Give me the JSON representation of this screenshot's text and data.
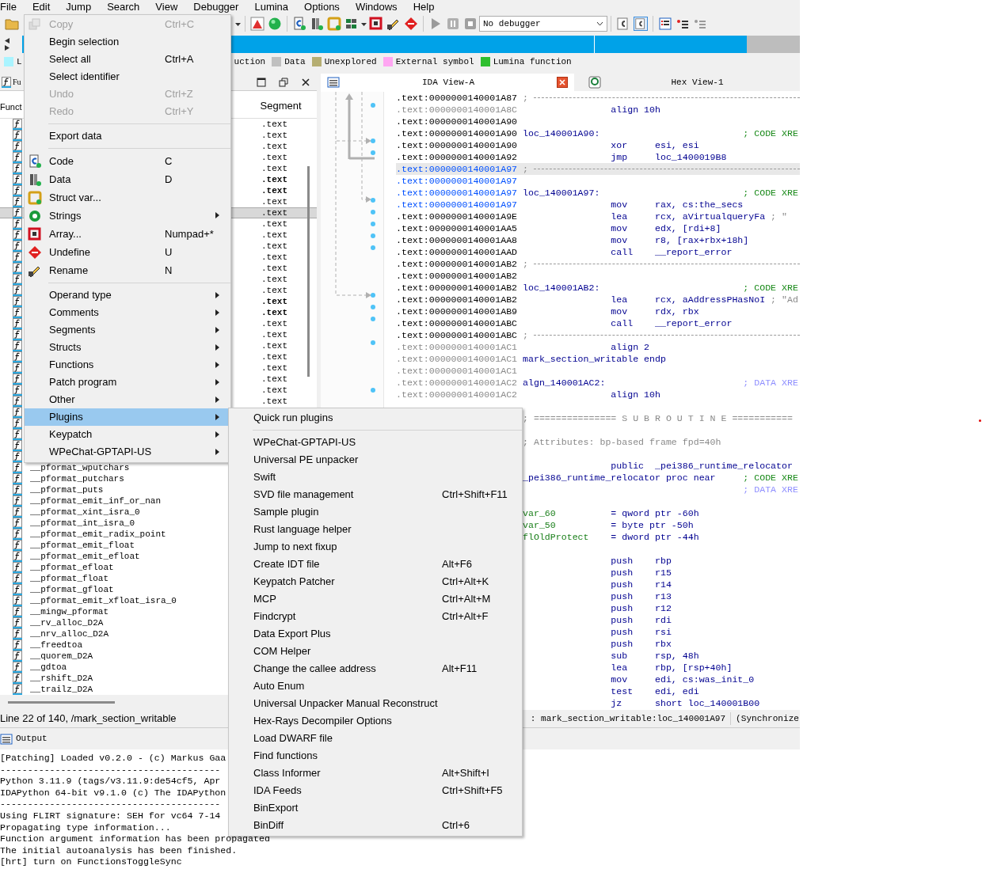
{
  "menubar": [
    {
      "label": "File"
    },
    {
      "label": "Edit"
    },
    {
      "label": "Jump"
    },
    {
      "label": "Search"
    },
    {
      "label": "View"
    },
    {
      "label": "Debugger"
    },
    {
      "label": "Lumina"
    },
    {
      "label": "Options"
    },
    {
      "label": "Windows"
    },
    {
      "label": "Help"
    }
  ],
  "toolbar": {
    "debugger_select": "No debugger"
  },
  "legend": [
    {
      "label": "L",
      "color": "#aaf4ff"
    },
    {
      "label": "uction"
    },
    {
      "label": "Data",
      "color": "#c0c0c0"
    },
    {
      "label": "Unexplored",
      "color": "#b5ae72"
    },
    {
      "label": "External symbol",
      "color": "#ffa6f2"
    },
    {
      "label": "Lumina function",
      "color": "#2fbf2f"
    }
  ],
  "functions": {
    "tab": "Fu",
    "column_1": "Funct",
    "column_2": "Segment",
    "status": "Line 22 of 140, /mark_section_writable",
    "rows": [
      {
        "segment": ".text",
        "bold": false,
        "selected": false
      },
      {
        "segment": ".text",
        "bold": false,
        "selected": false
      },
      {
        "segment": ".text",
        "bold": false,
        "selected": false
      },
      {
        "segment": ".text",
        "bold": false,
        "selected": false
      },
      {
        "segment": ".text",
        "bold": false,
        "selected": false
      },
      {
        "segment": ".text",
        "bold": true,
        "selected": false
      },
      {
        "segment": ".text",
        "bold": true,
        "selected": false
      },
      {
        "segment": ".text",
        "bold": false,
        "selected": false
      },
      {
        "segment": ".text",
        "bold": false,
        "selected": true
      },
      {
        "segment": ".text",
        "bold": false,
        "selected": false
      },
      {
        "segment": ".text",
        "bold": false,
        "selected": false
      },
      {
        "segment": ".text",
        "bold": false,
        "selected": false
      },
      {
        "segment": ".text",
        "bold": false,
        "selected": false
      },
      {
        "segment": ".text",
        "bold": false,
        "selected": false
      },
      {
        "segment": ".text",
        "bold": false,
        "selected": false
      },
      {
        "segment": ".text",
        "bold": false,
        "selected": false
      },
      {
        "segment": ".text",
        "bold": true,
        "selected": false
      },
      {
        "segment": ".text",
        "bold": true,
        "selected": false
      },
      {
        "segment": ".text",
        "bold": false,
        "selected": false
      },
      {
        "segment": ".text",
        "bold": false,
        "selected": false
      },
      {
        "segment": ".text",
        "bold": false,
        "selected": false
      },
      {
        "segment": ".text",
        "bold": false,
        "selected": false
      },
      {
        "segment": ".text",
        "bold": false,
        "selected": false
      },
      {
        "segment": ".text",
        "bold": false,
        "selected": false
      },
      {
        "segment": ".text",
        "bold": false,
        "selected": false
      },
      {
        "segment": ".text",
        "bold": false,
        "selected": false
      },
      {
        "selected": false
      },
      {
        "selected": false
      },
      {
        "selected": false
      },
      {
        "selected": false
      },
      {
        "selected": false
      },
      {
        "name": "__pformat_wputchars",
        "selected": false
      },
      {
        "name": "__pformat_putchars",
        "selected": false
      },
      {
        "name": "__pformat_puts",
        "selected": false
      },
      {
        "name": "__pformat_emit_inf_or_nan",
        "selected": false
      },
      {
        "name": "__pformat_xint_isra_0",
        "selected": false
      },
      {
        "name": "__pformat_int_isra_0",
        "selected": false
      },
      {
        "name": "__pformat_emit_radix_point",
        "selected": false
      },
      {
        "name": "__pformat_emit_float",
        "selected": false
      },
      {
        "name": "__pformat_emit_efloat",
        "selected": false
      },
      {
        "name": "__pformat_efloat",
        "selected": false
      },
      {
        "name": "__pformat_float",
        "selected": false
      },
      {
        "name": "__pformat_gfloat",
        "selected": false
      },
      {
        "name": "__pformat_emit_xfloat_isra_0",
        "selected": false
      },
      {
        "name": "__mingw_pformat",
        "selected": false
      },
      {
        "name": "__rv_alloc_D2A",
        "selected": false
      },
      {
        "name": "__nrv_alloc_D2A",
        "selected": false
      },
      {
        "name": "__freedtoa",
        "selected": false
      },
      {
        "name": "__quorem_D2A",
        "selected": false
      },
      {
        "name": "__gdtoa",
        "selected": false
      },
      {
        "name": "__rshift_D2A",
        "selected": false
      },
      {
        "name": "__trailz_D2A",
        "selected": false
      }
    ]
  },
  "views": [
    {
      "title": "IDA View-A",
      "selected": true
    },
    {
      "title": "Hex View-1",
      "selected": false
    }
  ],
  "ida_view": {
    "status": ": mark_section_writable:loc_140001A97",
    "status_2": "(Synchronize",
    "lines": [
      {
        "kind": "code",
        "addr": ".text:0000000140001A87",
        "selected": false,
        "current": false,
        "greyed": false,
        "separator": ";"
      },
      {
        "kind": "code",
        "addr": ".text:0000000140001A8C",
        "selected": false,
        "current": false,
        "greyed": true,
        "mnem": "align 10h"
      },
      {
        "kind": "code",
        "addr": ".text:0000000140001A90",
        "selected": false,
        "current": false,
        "greyed": false
      },
      {
        "kind": "code",
        "addr": ".text:0000000140001A90",
        "selected": false,
        "current": false,
        "greyed": false,
        "label": "loc_140001A90:",
        "code_xref": "; CODE XRE"
      },
      {
        "kind": "code",
        "addr": ".text:0000000140001A90",
        "selected": false,
        "current": false,
        "greyed": false,
        "mnem": "xor",
        "ops": "esi, esi"
      },
      {
        "kind": "code",
        "addr": ".text:0000000140001A92",
        "selected": false,
        "current": false,
        "greyed": false,
        "mnem": "jmp",
        "ops": "loc_1400019B8"
      },
      {
        "kind": "code",
        "addr": ".text:0000000140001A97",
        "selected": true,
        "current": true,
        "greyed": false,
        "separator": ";"
      },
      {
        "kind": "code",
        "addr": ".text:0000000140001A97",
        "selected": true,
        "current": false,
        "greyed": false
      },
      {
        "kind": "code",
        "addr": ".text:0000000140001A97",
        "selected": true,
        "current": false,
        "greyed": false,
        "label": "loc_140001A97:",
        "code_xref": "; CODE XRE"
      },
      {
        "kind": "code",
        "addr": ".text:0000000140001A97",
        "selected": true,
        "current": false,
        "greyed": false,
        "mnem": "mov",
        "ops": "rax, cs:the_secs"
      },
      {
        "kind": "code",
        "addr": ".text:0000000140001A9E",
        "selected": false,
        "current": false,
        "greyed": false,
        "mnem": "lea",
        "ops": "rcx, aVirtualqueryFa",
        "comment": "; \""
      },
      {
        "kind": "code",
        "addr": ".text:0000000140001AA5",
        "selected": false,
        "current": false,
        "greyed": false,
        "mnem": "mov",
        "ops": "edx, [rdi+8]"
      },
      {
        "kind": "code",
        "addr": ".text:0000000140001AA8",
        "selected": false,
        "current": false,
        "greyed": false,
        "mnem": "mov",
        "ops": "r8, [rax+rbx+18h]"
      },
      {
        "kind": "code",
        "addr": ".text:0000000140001AAD",
        "selected": false,
        "current": false,
        "greyed": false,
        "mnem": "call",
        "ops": "__report_error"
      },
      {
        "kind": "code",
        "addr": ".text:0000000140001AB2",
        "selected": false,
        "current": false,
        "greyed": false,
        "separator": ";"
      },
      {
        "kind": "code",
        "addr": ".text:0000000140001AB2",
        "selected": false,
        "current": false,
        "greyed": false
      },
      {
        "kind": "code",
        "addr": ".text:0000000140001AB2",
        "selected": false,
        "current": false,
        "greyed": false,
        "label": "loc_140001AB2:",
        "code_xref": "; CODE XRE"
      },
      {
        "kind": "code",
        "addr": ".text:0000000140001AB2",
        "selected": false,
        "current": false,
        "greyed": false,
        "mnem": "lea",
        "ops": "rcx, aAddressPHasNoI",
        "comment": "; \"Ad"
      },
      {
        "kind": "code",
        "addr": ".text:0000000140001AB9",
        "selected": false,
        "current": false,
        "greyed": false,
        "mnem": "mov",
        "ops": "rdx, rbx"
      },
      {
        "kind": "code",
        "addr": ".text:0000000140001ABC",
        "selected": false,
        "current": false,
        "greyed": false,
        "mnem": "call",
        "ops": "__report_error"
      },
      {
        "kind": "code",
        "addr": ".text:0000000140001ABC",
        "selected": false,
        "current": false,
        "greyed": false,
        "separator": ";"
      },
      {
        "kind": "code",
        "addr": ".text:0000000140001AC1",
        "selected": false,
        "current": false,
        "greyed": true,
        "mnem": "align 2"
      },
      {
        "kind": "code",
        "addr": ".text:0000000140001AC1",
        "selected": false,
        "current": false,
        "greyed": true,
        "label": "mark_section_writable endp"
      },
      {
        "kind": "code",
        "addr": ".text:0000000140001AC1",
        "selected": false,
        "current": false,
        "greyed": true
      },
      {
        "kind": "code",
        "addr": ".text:0000000140001AC2",
        "selected": false,
        "current": false,
        "greyed": true,
        "label": "algn_140001AC2:",
        "data_xref": "; DATA XRE"
      },
      {
        "kind": "code",
        "addr": ".text:0000000140001AC2",
        "selected": false,
        "current": false,
        "greyed": true,
        "mnem": "align 10h"
      },
      {
        "kind": "blank"
      },
      {
        "kind": "code",
        "banner": "; =============== S U B R O U T I N E ==========="
      },
      {
        "kind": "blank"
      },
      {
        "kind": "code",
        "banner": "; Attributes: bp-based frame fpd=40h"
      },
      {
        "kind": "blank"
      },
      {
        "kind": "code",
        "mnem": "public",
        "ops": "_pei386_runtime_relocator"
      },
      {
        "kind": "code",
        "label": "_pei386_runtime_relocator proc near",
        "code_xref": "; CODE XRE"
      },
      {
        "kind": "code",
        "data_xref": "; DATA XRE"
      },
      {
        "kind": "blank"
      },
      {
        "kind": "code",
        "var": "var_60",
        "mnem": "= qword ptr -60h"
      },
      {
        "kind": "code",
        "var": "var_50",
        "mnem": "= byte ptr -50h"
      },
      {
        "kind": "code",
        "var": "flOldProtect",
        "mnem": "= dword ptr -44h"
      },
      {
        "kind": "blank"
      },
      {
        "kind": "code",
        "mnem": "push",
        "ops": "rbp"
      },
      {
        "kind": "code",
        "mnem": "push",
        "ops": "r15"
      },
      {
        "kind": "code",
        "mnem": "push",
        "ops": "r14"
      },
      {
        "kind": "code",
        "mnem": "push",
        "ops": "r13"
      },
      {
        "kind": "code",
        "mnem": "push",
        "ops": "r12"
      },
      {
        "kind": "code",
        "mnem": "push",
        "ops": "rdi"
      },
      {
        "kind": "code",
        "mnem": "push",
        "ops": "rsi"
      },
      {
        "kind": "code",
        "mnem": "push",
        "ops": "rbx"
      },
      {
        "kind": "code",
        "mnem": "sub",
        "ops": "rsp, 48h"
      },
      {
        "kind": "code",
        "mnem": "lea",
        "ops": "rbp, [rsp+40h]"
      },
      {
        "kind": "code",
        "mnem": "mov",
        "ops": "edi, cs:was_init_0"
      },
      {
        "kind": "code",
        "mnem": "test",
        "ops": "edi, edi"
      },
      {
        "kind": "code",
        "mnem": "jz",
        "ops": "short loc_140001B00"
      }
    ]
  },
  "output": {
    "tab": "Output",
    "lines": [
      "[Patching] Loaded v0.2.0 - (c) Markus Gaa",
      "----------------------------------------",
      "Python 3.11.9 (tags/v3.11.9:de54cf5, Apr",
      "IDAPython 64-bit v9.1.0 (c) The IDAPython",
      "----------------------------------------",
      "Using FLIRT signature: SEH for vc64 7-14",
      "Propagating type information...",
      "Function argument information has been propagated",
      "The initial autoanalysis has been finished.",
      "[hrt] turn on FunctionsToggleSync"
    ]
  },
  "edit_menu": {
    "items": [
      {
        "kind": "item",
        "label": "Copy",
        "shortcut": "Ctrl+C",
        "disabled": true,
        "selected": false,
        "submenu": false
      },
      {
        "kind": "item",
        "label": "Begin selection",
        "disabled": false,
        "selected": false,
        "submenu": false
      },
      {
        "kind": "item",
        "label": "Select all",
        "shortcut": "Ctrl+A",
        "disabled": false,
        "selected": false,
        "submenu": false
      },
      {
        "kind": "item",
        "label": "Select identifier",
        "disabled": false,
        "selected": false,
        "submenu": false
      },
      {
        "kind": "item",
        "label": "Undo",
        "shortcut": "Ctrl+Z",
        "disabled": true,
        "selected": false,
        "submenu": false
      },
      {
        "kind": "item",
        "label": "Redo",
        "shortcut": "Ctrl+Y",
        "disabled": true,
        "selected": false,
        "submenu": false
      },
      {
        "kind": "separator"
      },
      {
        "kind": "item",
        "label": "Export data",
        "disabled": false,
        "selected": false,
        "submenu": false
      },
      {
        "kind": "separator"
      },
      {
        "kind": "item",
        "label": "Code",
        "shortcut": "C",
        "disabled": false,
        "selected": false,
        "submenu": false
      },
      {
        "kind": "item",
        "label": "Data",
        "shortcut": "D",
        "disabled": false,
        "selected": false,
        "submenu": false
      },
      {
        "kind": "item",
        "label": "Struct var...",
        "disabled": false,
        "selected": false,
        "submenu": false
      },
      {
        "kind": "item",
        "label": "Strings",
        "submenu": true,
        "disabled": false,
        "selected": false
      },
      {
        "kind": "item",
        "label": "Array...",
        "shortcut": "Numpad+*",
        "disabled": false,
        "selected": false,
        "submenu": false
      },
      {
        "kind": "item",
        "label": "Undefine",
        "shortcut": "U",
        "disabled": false,
        "selected": false,
        "submenu": false
      },
      {
        "kind": "item",
        "label": "Rename",
        "shortcut": "N",
        "disabled": false,
        "selected": false,
        "submenu": false
      },
      {
        "kind": "separator"
      },
      {
        "kind": "item",
        "label": "Operand type",
        "submenu": true,
        "disabled": false,
        "selected": false
      },
      {
        "kind": "item",
        "label": "Comments",
        "submenu": true,
        "disabled": false,
        "selected": false
      },
      {
        "kind": "item",
        "label": "Segments",
        "submenu": true,
        "disabled": false,
        "selected": false
      },
      {
        "kind": "item",
        "label": "Structs",
        "submenu": true,
        "disabled": false,
        "selected": false
      },
      {
        "kind": "item",
        "label": "Functions",
        "submenu": true,
        "disabled": false,
        "selected": false
      },
      {
        "kind": "item",
        "label": "Patch program",
        "submenu": true,
        "disabled": false,
        "selected": false
      },
      {
        "kind": "item",
        "label": "Other",
        "submenu": true,
        "disabled": false,
        "selected": false
      },
      {
        "kind": "item",
        "label": "Plugins",
        "submenu": true,
        "disabled": false,
        "selected": true
      },
      {
        "kind": "item",
        "label": "Keypatch",
        "submenu": true,
        "disabled": false,
        "selected": false
      },
      {
        "kind": "item",
        "label": "WPeChat-GPTAPI-US",
        "submenu": true,
        "disabled": false,
        "selected": false
      }
    ]
  },
  "plugins_menu": {
    "items": [
      {
        "kind": "item",
        "label": "Quick run plugins"
      },
      {
        "kind": "separator"
      },
      {
        "kind": "item",
        "label": "WPeChat-GPTAPI-US"
      },
      {
        "kind": "item",
        "label": "Universal PE unpacker"
      },
      {
        "kind": "item",
        "label": "Swift"
      },
      {
        "kind": "item",
        "label": "SVD file management",
        "shortcut": "Ctrl+Shift+F11"
      },
      {
        "kind": "item",
        "label": "Sample plugin"
      },
      {
        "kind": "item",
        "label": "Rust language helper"
      },
      {
        "kind": "item",
        "label": "Jump to next fixup"
      },
      {
        "kind": "item",
        "label": "Create IDT file",
        "shortcut": "Alt+F6"
      },
      {
        "kind": "item",
        "label": "Keypatch Patcher",
        "shortcut": "Ctrl+Alt+K"
      },
      {
        "kind": "item",
        "label": "MCP",
        "shortcut": "Ctrl+Alt+M"
      },
      {
        "kind": "item",
        "label": "Findcrypt",
        "shortcut": "Ctrl+Alt+F"
      },
      {
        "kind": "item",
        "label": "Data Export Plus"
      },
      {
        "kind": "item",
        "label": "COM Helper"
      },
      {
        "kind": "item",
        "label": "Change the callee address",
        "shortcut": "Alt+F11"
      },
      {
        "kind": "item",
        "label": "Auto Enum"
      },
      {
        "kind": "item",
        "label": "Universal Unpacker Manual Reconstruct"
      },
      {
        "kind": "item",
        "label": "Hex-Rays Decompiler Options"
      },
      {
        "kind": "item",
        "label": "Load DWARF file"
      },
      {
        "kind": "item",
        "label": "Find functions"
      },
      {
        "kind": "item",
        "label": "Class Informer",
        "shortcut": "Alt+Shift+I"
      },
      {
        "kind": "item",
        "label": "IDA Feeds",
        "shortcut": "Ctrl+Shift+F5"
      },
      {
        "kind": "item",
        "label": "BinExport"
      },
      {
        "kind": "item",
        "label": "BinDiff",
        "shortcut": "Ctrl+6"
      }
    ]
  }
}
